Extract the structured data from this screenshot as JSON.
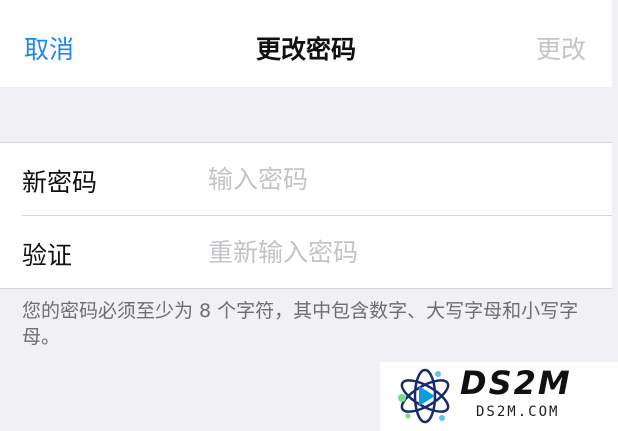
{
  "navbar": {
    "cancel_label": "取消",
    "title": "更改密码",
    "done_label": "更改"
  },
  "form": {
    "new_password": {
      "label": "新密码",
      "placeholder": "输入密码",
      "value": ""
    },
    "verify": {
      "label": "验证",
      "placeholder": "重新输入密码",
      "value": ""
    }
  },
  "hint_text": "您的密码必须至少为 8 个字符，其中包含数字、大写字母和小写字母。",
  "watermark": {
    "main_text": "DS2M",
    "sub_text": "DS2M.COM"
  },
  "colors": {
    "accent": "#1e86f0",
    "disabled": "#c4c4c7",
    "background": "#f0f0f5"
  }
}
